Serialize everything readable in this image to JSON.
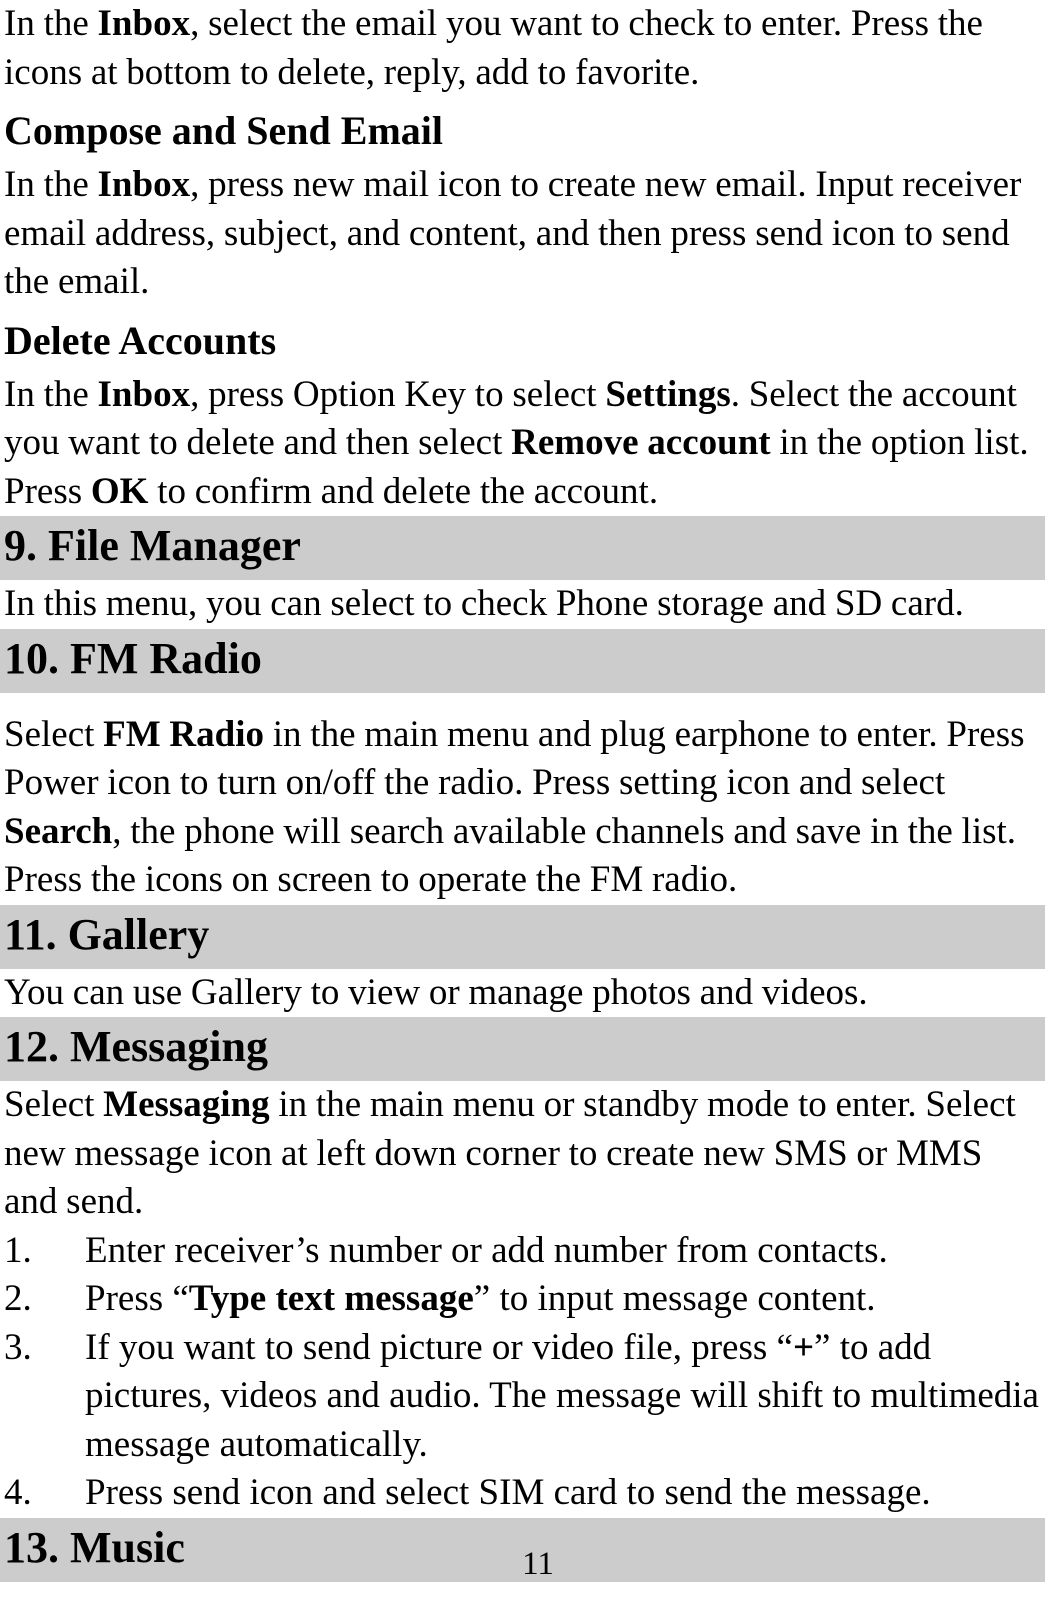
{
  "document": {
    "page_number": "11",
    "shade_color": "#cccccc",
    "text_color": "#000000",
    "background_color": "#ffffff"
  },
  "blocks": [
    {
      "type": "paragraph",
      "name": "inbox-intro-paragraph",
      "runs": [
        {
          "text": "In the ",
          "bold": false
        },
        {
          "text": "Inbox",
          "bold": true
        },
        {
          "text": ", select the email you want to check to enter. Press the icons at bottom to delete, reply, add to favorite.",
          "bold": false
        }
      ]
    },
    {
      "type": "subheading",
      "name": "compose-and-send-email-heading",
      "runs": [
        {
          "text": "Compose and Send Email",
          "bold": true
        }
      ]
    },
    {
      "type": "paragraph",
      "name": "compose-and-send-email-paragraph",
      "runs": [
        {
          "text": "In the ",
          "bold": false
        },
        {
          "text": "Inbox",
          "bold": true
        },
        {
          "text": ", press new mail icon to create new email. Input receiver email address, subject, and content, and then press send icon to send the email.",
          "bold": false
        }
      ]
    },
    {
      "type": "subheading",
      "name": "delete-accounts-heading",
      "runs": [
        {
          "text": "Delete Accounts",
          "bold": true
        }
      ]
    },
    {
      "type": "paragraph",
      "name": "delete-accounts-paragraph",
      "runs": [
        {
          "text": "In the ",
          "bold": false
        },
        {
          "text": "Inbox",
          "bold": true
        },
        {
          "text": ", press Option Key to select ",
          "bold": false
        },
        {
          "text": "Settings",
          "bold": true
        },
        {
          "text": ". Select the account you want to delete and then select ",
          "bold": false
        },
        {
          "text": "Remove account",
          "bold": true
        },
        {
          "text": " in the option list. Press ",
          "bold": false
        },
        {
          "text": "OK",
          "bold": true
        },
        {
          "text": " to confirm and delete the account.",
          "bold": false
        }
      ]
    },
    {
      "type": "chapter",
      "name": "chapter-file-manager",
      "runs": [
        {
          "text": "9. File Manager",
          "bold": true
        }
      ]
    },
    {
      "type": "paragraph",
      "name": "file-manager-paragraph",
      "runs": [
        {
          "text": "In this menu, you can select to check Phone storage and SD card.",
          "bold": false
        }
      ]
    },
    {
      "type": "chapter",
      "name": "chapter-fm-radio",
      "runs": [
        {
          "text": "10. FM Radio",
          "bold": true
        }
      ]
    },
    {
      "type": "spacer",
      "name": "spacer-after-fm-radio-heading",
      "size": "md"
    },
    {
      "type": "paragraph",
      "name": "fm-radio-paragraph",
      "runs": [
        {
          "text": "Select ",
          "bold": false
        },
        {
          "text": "FM Radio",
          "bold": true
        },
        {
          "text": " in the main menu and plug earphone to enter. Press Power icon to turn on/off the radio. Press setting icon and select ",
          "bold": false
        },
        {
          "text": "Search",
          "bold": true
        },
        {
          "text": ", the phone will search available channels and save in the list. Press the icons on screen to operate the FM radio.",
          "bold": false
        }
      ]
    },
    {
      "type": "chapter",
      "name": "chapter-gallery",
      "runs": [
        {
          "text": "11. Gallery",
          "bold": true
        }
      ]
    },
    {
      "type": "paragraph",
      "name": "gallery-paragraph",
      "runs": [
        {
          "text": "You can use Gallery to view or manage photos and videos.",
          "bold": false
        }
      ]
    },
    {
      "type": "chapter",
      "name": "chapter-messaging",
      "runs": [
        {
          "text": "12. Messaging",
          "bold": true
        }
      ]
    },
    {
      "type": "paragraph",
      "name": "messaging-paragraph",
      "runs": [
        {
          "text": "Select ",
          "bold": false
        },
        {
          "text": "Messaging",
          "bold": true
        },
        {
          "text": " in the main menu or standby mode to enter. Select new message icon at left down corner to create new SMS or MMS and send.",
          "bold": false
        }
      ]
    },
    {
      "type": "list",
      "name": "messaging-steps-list",
      "items": [
        {
          "name": "messaging-step-1",
          "marker": "1.",
          "runs": [
            {
              "text": "Enter receiver’s number or add number from contacts.",
              "bold": false
            }
          ]
        },
        {
          "name": "messaging-step-2",
          "marker": "2.",
          "runs": [
            {
              "text": "Press “",
              "bold": false
            },
            {
              "text": "Type text message",
              "bold": true
            },
            {
              "text": "” to input message content.",
              "bold": false
            }
          ]
        },
        {
          "name": "messaging-step-3",
          "marker": "3.",
          "runs": [
            {
              "text": "If you want to send picture or video file, press “",
              "bold": false
            },
            {
              "text": "+",
              "bold": true
            },
            {
              "text": "” to add pictures, videos and audio. The message will shift to multimedia message automatically.",
              "bold": false
            }
          ]
        },
        {
          "name": "messaging-step-4",
          "marker": "4.",
          "runs": [
            {
              "text": "Press send icon and select SIM card to send the message.",
              "bold": false
            }
          ]
        }
      ]
    },
    {
      "type": "chapter",
      "name": "chapter-music",
      "runs": [
        {
          "text": "13. Music",
          "bold": true
        }
      ]
    }
  ]
}
